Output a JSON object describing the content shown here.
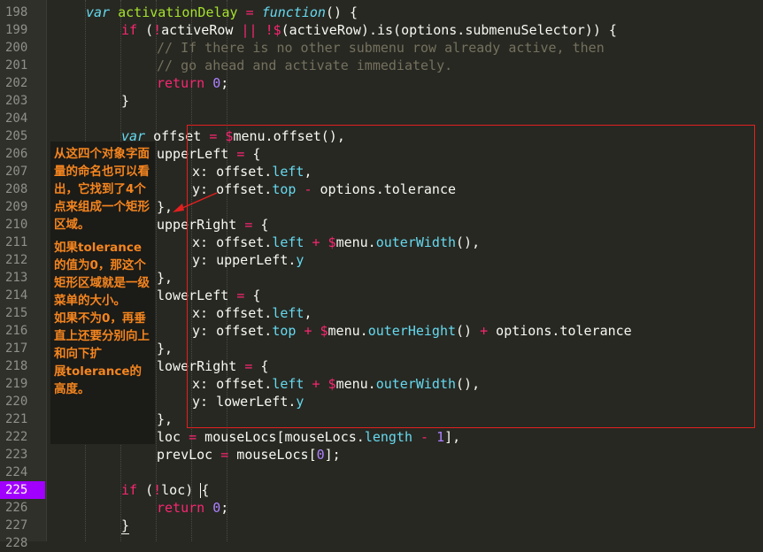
{
  "editor": {
    "theme_colors": {
      "background": "#272822",
      "keyword": "#66d9ef",
      "control": "#f92672",
      "function": "#a6e22e",
      "number": "#ae81ff",
      "comment": "#75715e",
      "active_line": "#a100ff",
      "annotation_text": "#f5851f",
      "highlight_box": "#e32020"
    },
    "active_line_number": "225",
    "line_numbers": [
      "198",
      "199",
      "200",
      "201",
      "202",
      "203",
      "204",
      "205",
      "206",
      "207",
      "208",
      "209",
      "210",
      "211",
      "212",
      "213",
      "214",
      "215",
      "216",
      "217",
      "218",
      "219",
      "220",
      "221",
      "222",
      "223",
      "224",
      "225",
      "226",
      "227",
      "228"
    ],
    "code_lines": [
      {
        "indent": 2,
        "tokens": [
          [
            "kw",
            "var"
          ],
          [
            "t",
            " "
          ],
          [
            "fn",
            "activationDelay"
          ],
          [
            "t",
            " "
          ],
          [
            "op",
            "="
          ],
          [
            "t",
            " "
          ],
          [
            "kw",
            "function"
          ],
          [
            "t",
            "() {"
          ]
        ]
      },
      {
        "indent": 4,
        "tokens": [
          [
            "ctl",
            "if"
          ],
          [
            "t",
            " ("
          ],
          [
            "op",
            "!"
          ],
          [
            "t",
            "activeRow "
          ],
          [
            "op",
            "||"
          ],
          [
            "t",
            " "
          ],
          [
            "op",
            "!$"
          ],
          [
            "t",
            "(activeRow).is(options.submenuSelector)) {"
          ]
        ]
      },
      {
        "indent": 6,
        "tokens": [
          [
            "cm",
            "// If there is no other submenu row already active, then"
          ]
        ]
      },
      {
        "indent": 6,
        "tokens": [
          [
            "cm",
            "// go ahead and activate immediately."
          ]
        ]
      },
      {
        "indent": 6,
        "tokens": [
          [
            "ctl",
            "return"
          ],
          [
            "t",
            " "
          ],
          [
            "num",
            "0"
          ],
          [
            "t",
            ";"
          ]
        ]
      },
      {
        "indent": 4,
        "tokens": [
          [
            "t",
            "}"
          ]
        ]
      },
      {
        "indent": 0,
        "tokens": []
      },
      {
        "indent": 4,
        "tokens": [
          [
            "kw",
            "var"
          ],
          [
            "t",
            " offset "
          ],
          [
            "op",
            "="
          ],
          [
            "t",
            " "
          ],
          [
            "op",
            "$"
          ],
          [
            "t",
            "menu.offset(),"
          ]
        ]
      },
      {
        "indent": 6,
        "tokens": [
          [
            "t",
            "upperLeft "
          ],
          [
            "op",
            "="
          ],
          [
            "t",
            " {"
          ]
        ]
      },
      {
        "indent": 8,
        "tokens": [
          [
            "t",
            "x: offset."
          ],
          [
            "prop",
            "left"
          ],
          [
            "t",
            ","
          ]
        ]
      },
      {
        "indent": 8,
        "tokens": [
          [
            "t",
            "y: offset."
          ],
          [
            "prop",
            "top"
          ],
          [
            "t",
            " "
          ],
          [
            "op",
            "-"
          ],
          [
            "t",
            " options.tolerance"
          ]
        ]
      },
      {
        "indent": 6,
        "tokens": [
          [
            "t",
            "},"
          ]
        ]
      },
      {
        "indent": 6,
        "tokens": [
          [
            "t",
            "upperRight "
          ],
          [
            "op",
            "="
          ],
          [
            "t",
            " {"
          ]
        ]
      },
      {
        "indent": 8,
        "tokens": [
          [
            "t",
            "x: offset."
          ],
          [
            "prop",
            "left"
          ],
          [
            "t",
            " "
          ],
          [
            "op",
            "+"
          ],
          [
            "t",
            " "
          ],
          [
            "op",
            "$"
          ],
          [
            "t",
            "menu."
          ],
          [
            "prop",
            "outerWidth"
          ],
          [
            "t",
            "(),"
          ]
        ]
      },
      {
        "indent": 8,
        "tokens": [
          [
            "t",
            "y: upperLeft."
          ],
          [
            "prop",
            "y"
          ]
        ]
      },
      {
        "indent": 6,
        "tokens": [
          [
            "t",
            "},"
          ]
        ]
      },
      {
        "indent": 6,
        "tokens": [
          [
            "t",
            "lowerLeft "
          ],
          [
            "op",
            "="
          ],
          [
            "t",
            " {"
          ]
        ]
      },
      {
        "indent": 8,
        "tokens": [
          [
            "t",
            "x: offset."
          ],
          [
            "prop",
            "left"
          ],
          [
            "t",
            ","
          ]
        ]
      },
      {
        "indent": 8,
        "tokens": [
          [
            "t",
            "y: offset."
          ],
          [
            "prop",
            "top"
          ],
          [
            "t",
            " "
          ],
          [
            "op",
            "+"
          ],
          [
            "t",
            " "
          ],
          [
            "op",
            "$"
          ],
          [
            "t",
            "menu."
          ],
          [
            "prop",
            "outerHeight"
          ],
          [
            "t",
            "() "
          ],
          [
            "op",
            "+"
          ],
          [
            "t",
            " options.tolerance"
          ]
        ]
      },
      {
        "indent": 6,
        "tokens": [
          [
            "t",
            "},"
          ]
        ]
      },
      {
        "indent": 6,
        "tokens": [
          [
            "t",
            "lowerRight "
          ],
          [
            "op",
            "="
          ],
          [
            "t",
            " {"
          ]
        ]
      },
      {
        "indent": 8,
        "tokens": [
          [
            "t",
            "x: offset."
          ],
          [
            "prop",
            "left"
          ],
          [
            "t",
            " "
          ],
          [
            "op",
            "+"
          ],
          [
            "t",
            " "
          ],
          [
            "op",
            "$"
          ],
          [
            "t",
            "menu."
          ],
          [
            "prop",
            "outerWidth"
          ],
          [
            "t",
            "(),"
          ]
        ]
      },
      {
        "indent": 8,
        "tokens": [
          [
            "t",
            "y: lowerLeft."
          ],
          [
            "prop",
            "y"
          ]
        ]
      },
      {
        "indent": 6,
        "tokens": [
          [
            "t",
            "},"
          ]
        ]
      },
      {
        "indent": 6,
        "tokens": [
          [
            "t",
            "loc "
          ],
          [
            "op",
            "="
          ],
          [
            "t",
            " mouseLocs[mouseLocs."
          ],
          [
            "prop",
            "length"
          ],
          [
            "t",
            " "
          ],
          [
            "op",
            "-"
          ],
          [
            "t",
            " "
          ],
          [
            "num",
            "1"
          ],
          [
            "t",
            "],"
          ]
        ]
      },
      {
        "indent": 6,
        "tokens": [
          [
            "t",
            "prevLoc "
          ],
          [
            "op",
            "="
          ],
          [
            "t",
            " mouseLocs["
          ],
          [
            "num",
            "0"
          ],
          [
            "t",
            "];"
          ]
        ]
      },
      {
        "indent": 0,
        "tokens": []
      },
      {
        "indent": 4,
        "tokens": [
          [
            "ctl",
            "if"
          ],
          [
            "t",
            " ("
          ],
          [
            "op",
            "!"
          ],
          [
            "t",
            "loc) "
          ],
          [
            "cursor",
            "{"
          ]
        ]
      },
      {
        "indent": 6,
        "tokens": [
          [
            "ctl",
            "return"
          ],
          [
            "t",
            " "
          ],
          [
            "num",
            "0"
          ],
          [
            "t",
            ";"
          ]
        ]
      },
      {
        "indent": 4,
        "tokens": [
          [
            "bracket",
            "}"
          ]
        ]
      },
      {
        "indent": 0,
        "tokens": []
      }
    ]
  },
  "annotation": {
    "paragraphs": [
      "从这四个对象字面量的命名也可以看出，它找到了4个点来组成一个矩形区域。",
      "如果tolerance的值为0，那这个矩形区域就是一级菜单的大小。\n如果不为0，再垂直上还要分别向上和向下扩\n展tolerance的高度。"
    ]
  }
}
